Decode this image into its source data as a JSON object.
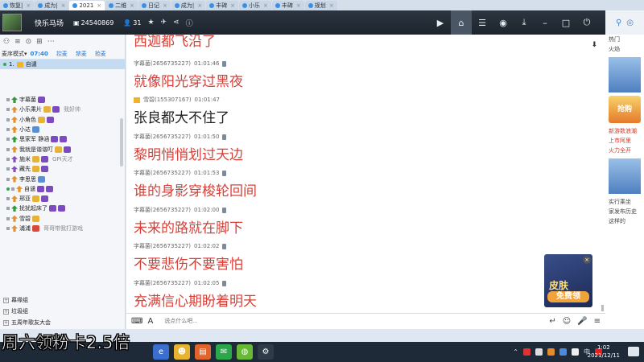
{
  "tabs": [
    {
      "label": "恢复|"
    },
    {
      "label": "成为|"
    },
    {
      "label": "2021"
    },
    {
      "label": "二维"
    },
    {
      "label": "日记"
    },
    {
      "label": "成为|"
    },
    {
      "label": "丰碑"
    },
    {
      "label": "小乐"
    },
    {
      "label": "丰碑"
    },
    {
      "label": "规划"
    }
  ],
  "header": {
    "room_name": "快乐马场",
    "room_id": "24540869",
    "online_count": "31"
  },
  "left": {
    "mode_label": "麦序模式",
    "mode_time": "07:40",
    "links": [
      "控麦",
      "禁麦",
      "抢麦"
    ],
    "me_index": "1.",
    "me_name": "自谴",
    "users": [
      {
        "name": "字幕菌",
        "sig": ""
      },
      {
        "name": "小乐乘片",
        "sig": "我好帅"
      },
      {
        "name": "小角色",
        "sig": ""
      },
      {
        "name": "小达",
        "sig": ""
      },
      {
        "name": "思家军 静涵",
        "sig": ""
      },
      {
        "name": "我就是谐谐叮",
        "sig": ""
      },
      {
        "name": "施米",
        "sig": "GPI天才"
      },
      {
        "name": "藏先",
        "sig": ""
      },
      {
        "name": "李思思",
        "sig": ""
      },
      {
        "name": "自谴",
        "sig": ""
      },
      {
        "name": "邢亚",
        "sig": ""
      },
      {
        "name": "扰扰起床了",
        "sig": ""
      },
      {
        "name": "雪碧",
        "sig": ""
      },
      {
        "name": "浦浦",
        "sig": "哥哥带我打游戏"
      }
    ],
    "groups": [
      "幕缘组",
      "垃圾组",
      "五周年歌友大会"
    ]
  },
  "chat": {
    "top_fragment": "西迦都飞沿了",
    "messages": [
      {
        "sender": "字幕菌(2656735227)",
        "time": "01:01:46",
        "text": "就像阳光穿过黑夜",
        "color": "red"
      },
      {
        "sender": "雪碧(155307167)",
        "time": "01:01:47",
        "text": "张良都大不住了",
        "color": "black"
      },
      {
        "sender": "字幕菌(2656735227)",
        "time": "01:01:50",
        "text": "黎明悄悄划过天边",
        "color": "red"
      },
      {
        "sender": "字幕菌(2656735227)",
        "time": "01:01:53",
        "text": "谁的身影穿梭轮回间",
        "color": "red"
      },
      {
        "sender": "字幕菌(2656735227)",
        "time": "01:02:00",
        "text": "未来的路就在脚下",
        "color": "red"
      },
      {
        "sender": "字幕菌(2656735227)",
        "time": "01:02:02",
        "text": "不要悲伤不要害怕",
        "color": "red"
      },
      {
        "sender": "字幕菌(2656735227)",
        "time": "01:02:05",
        "text": "充满信心期盼着明天",
        "color": "red"
      }
    ]
  },
  "ad": {
    "line1": "皮肤",
    "line2": "免费领"
  },
  "input": {
    "placeholder": "说点什么吧..."
  },
  "right_strip": {
    "lines": [
      {
        "text": "火焰",
        "color": "gray"
      },
      {
        "text": "新游数浪潮",
        "color": "red"
      },
      {
        "text": "上市阿里",
        "color": "red"
      },
      {
        "text": "火力全开",
        "color": "red"
      },
      {
        "text": "实行乘坐",
        "color": "gray"
      },
      {
        "text": "家发布历史",
        "color": "gray"
      },
      {
        "text": "这样的",
        "color": "gray"
      }
    ],
    "ad_text": "抢购",
    "hot": "热门"
  },
  "subtitle": "周六领粉卡2.5倍",
  "taskbar": {
    "time": "1:02",
    "date": "2021/12/11",
    "ime": "中"
  },
  "colors": {
    "accent": "#2a7de1",
    "message_red": "#d6413a",
    "header_bg": "#2c3540"
  }
}
